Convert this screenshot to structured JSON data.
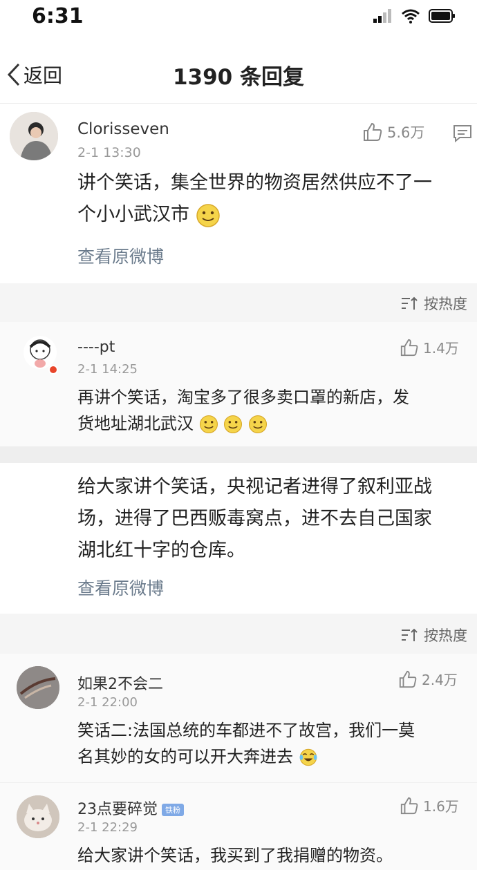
{
  "status": {
    "time": "6:31"
  },
  "nav": {
    "back_label": "返回",
    "title": "1390 条回复"
  },
  "main_post": {
    "username": "Clorisseven",
    "time": "2-1 13:30",
    "likes": "5.6万",
    "text_line1": "讲个笑话，集全世界的物资居然供应不了一",
    "text_line2": "个小小武汉市",
    "view_original": "查看原微博"
  },
  "sort_label": "按热度",
  "reply1": {
    "username": "----pt",
    "time": "2-1 14:25",
    "likes": "1.4万",
    "text_line1": "再讲个笑话，淘宝多了很多卖口罩的新店，发",
    "text_line2": "货地址湖北武汉"
  },
  "second_post": {
    "text_line1": "给大家讲个笑话，央视记者进得了叙利亚战",
    "text_line2": "场，进得了巴西贩毒窝点，进不去自己国家",
    "text_line3": "湖北红十字的仓库。",
    "view_original": "查看原微博"
  },
  "sort_label2": "按热度",
  "reply2": {
    "username": "如果2不会二",
    "time": "2-1 22:00",
    "likes": "2.4万",
    "text_line1": "笑话二:法国总统的车都进不了故宫，我们一莫",
    "text_line2": "名其妙的女的可以开大奔进去"
  },
  "reply3": {
    "username": "23点要碎觉",
    "badge": "铁粉",
    "time": "2-1 22:29",
    "likes": "1.6万",
    "text_line1": "给大家讲个笑话，我买到了我捐赠的物资。"
  },
  "colors": {
    "link": "#6b7b8c",
    "band": "#f5f5f5",
    "muted": "#999999"
  },
  "icons": [
    "signal-icon",
    "wifi-icon",
    "battery-icon",
    "back-chevron-icon",
    "thumb-up-icon",
    "comment-icon",
    "sort-icon",
    "smile-emoji-icon",
    "laugh-cry-emoji-icon"
  ]
}
